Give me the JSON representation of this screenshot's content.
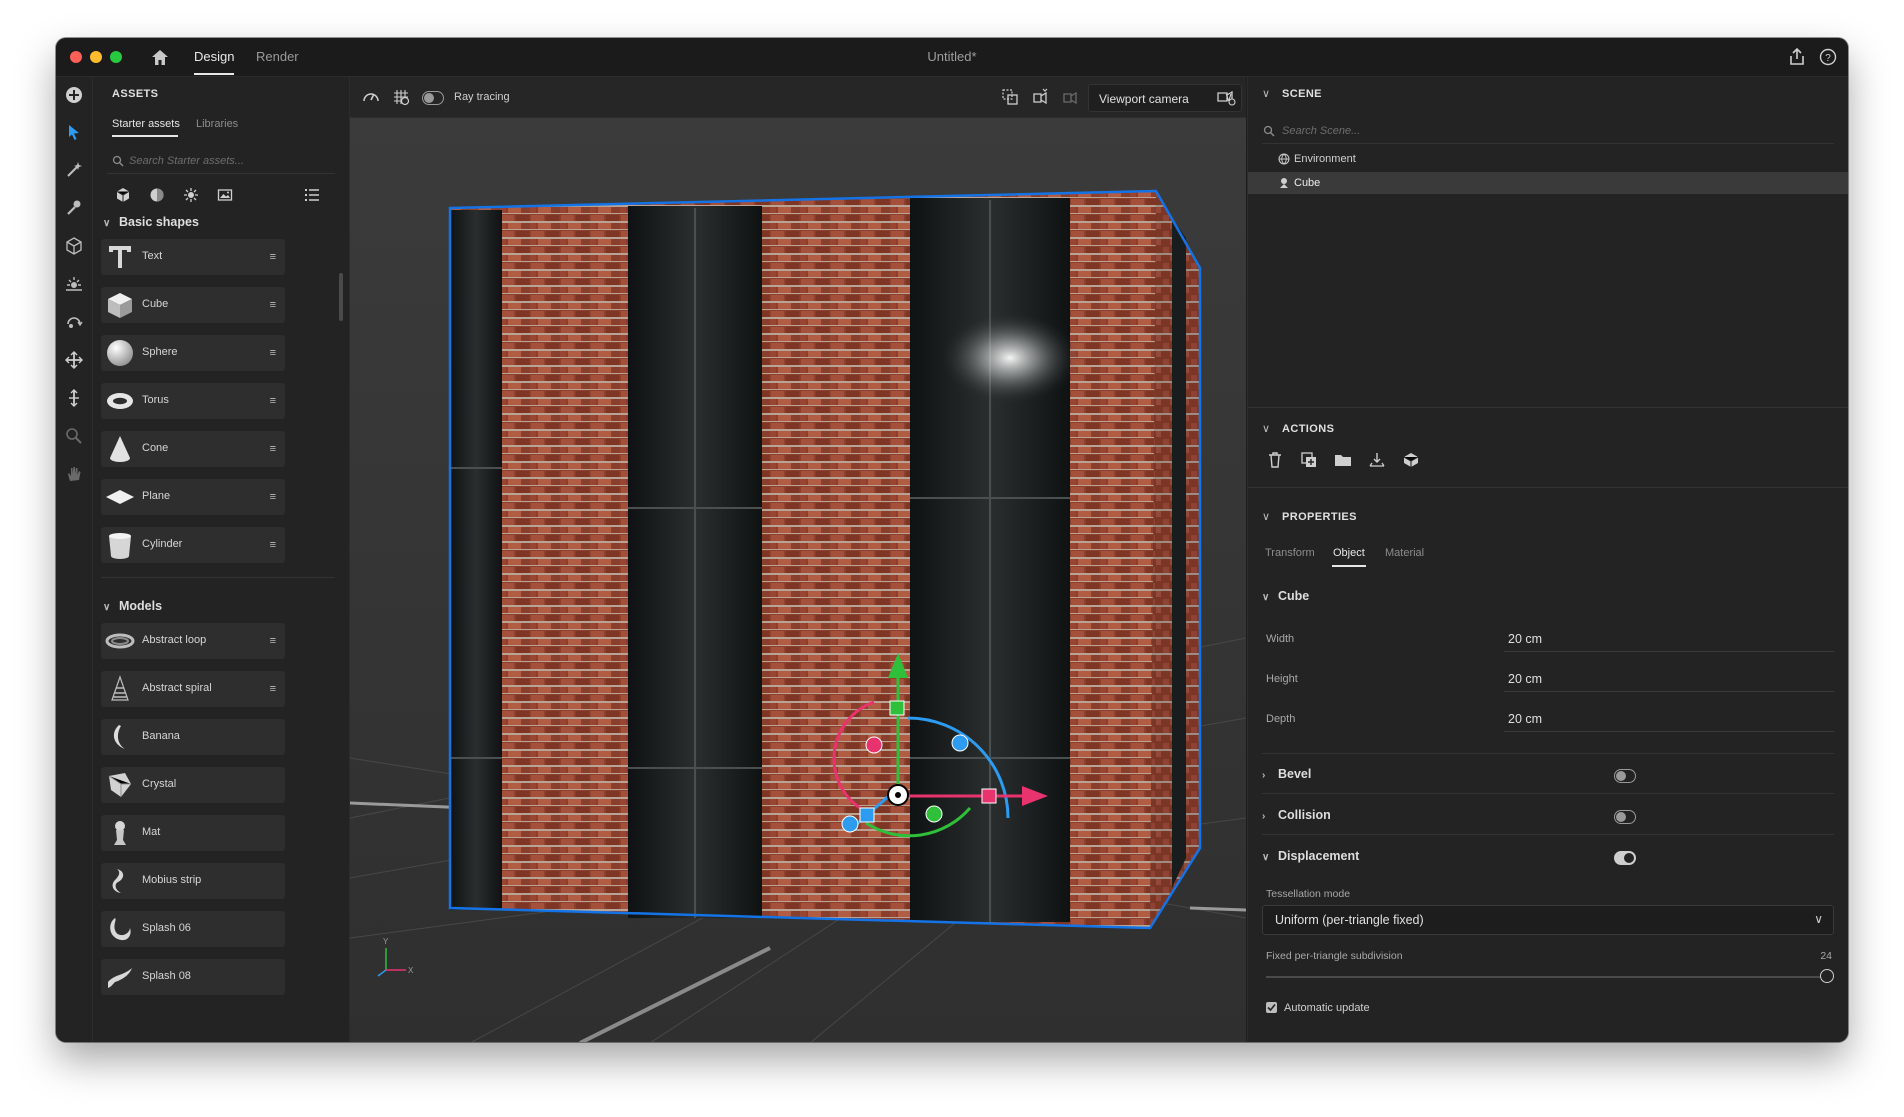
{
  "titlebar": {
    "tabs": [
      "Design",
      "Render"
    ],
    "document_title": "Untitled*"
  },
  "assets_panel": {
    "title": "ASSETS",
    "tabs": [
      "Starter assets",
      "Libraries"
    ],
    "search_placeholder": "Search Starter assets...",
    "basic_shapes_header": "Basic shapes",
    "basic_shapes": [
      "Text",
      "Cube",
      "Sphere",
      "Torus",
      "Cone",
      "Plane",
      "Cylinder"
    ],
    "models_header": "Models",
    "models": [
      "Abstract loop",
      "Abstract spiral",
      "Banana",
      "Crystal",
      "Mat",
      "Mobius strip",
      "Splash 06",
      "Splash 08"
    ]
  },
  "viewport": {
    "ray_tracing_label": "Ray tracing",
    "camera_select": "Viewport camera",
    "axis_y": "Y",
    "axis_x": "X"
  },
  "scene_panel": {
    "title": "SCENE",
    "search_placeholder": "Search Scene...",
    "items": [
      "Environment",
      "Cube"
    ]
  },
  "actions_panel": {
    "title": "ACTIONS"
  },
  "properties_panel": {
    "title": "PROPERTIES",
    "tabs": [
      "Transform",
      "Object",
      "Material"
    ],
    "cube_header": "Cube",
    "width_label": "Width",
    "width_value": "20 cm",
    "height_label": "Height",
    "height_value": "20 cm",
    "depth_label": "Depth",
    "depth_value": "20 cm",
    "bevel_label": "Bevel",
    "collision_label": "Collision",
    "displacement_label": "Displacement",
    "tessellation_label": "Tessellation mode",
    "tessellation_value": "Uniform (per-triangle fixed)",
    "subdivision_label": "Fixed per-triangle subdivision",
    "subdivision_value": "24",
    "auto_update_label": "Automatic update",
    "bevel_on": false,
    "collision_on": false,
    "displacement_on": true,
    "auto_update_checked": true
  },
  "colors": {
    "accent": "#1473e6",
    "gizmo_x": "#e8336f",
    "gizmo_y": "#2fbf3a",
    "gizmo_z": "#2d9bf0",
    "brick": "#8b3a28"
  }
}
